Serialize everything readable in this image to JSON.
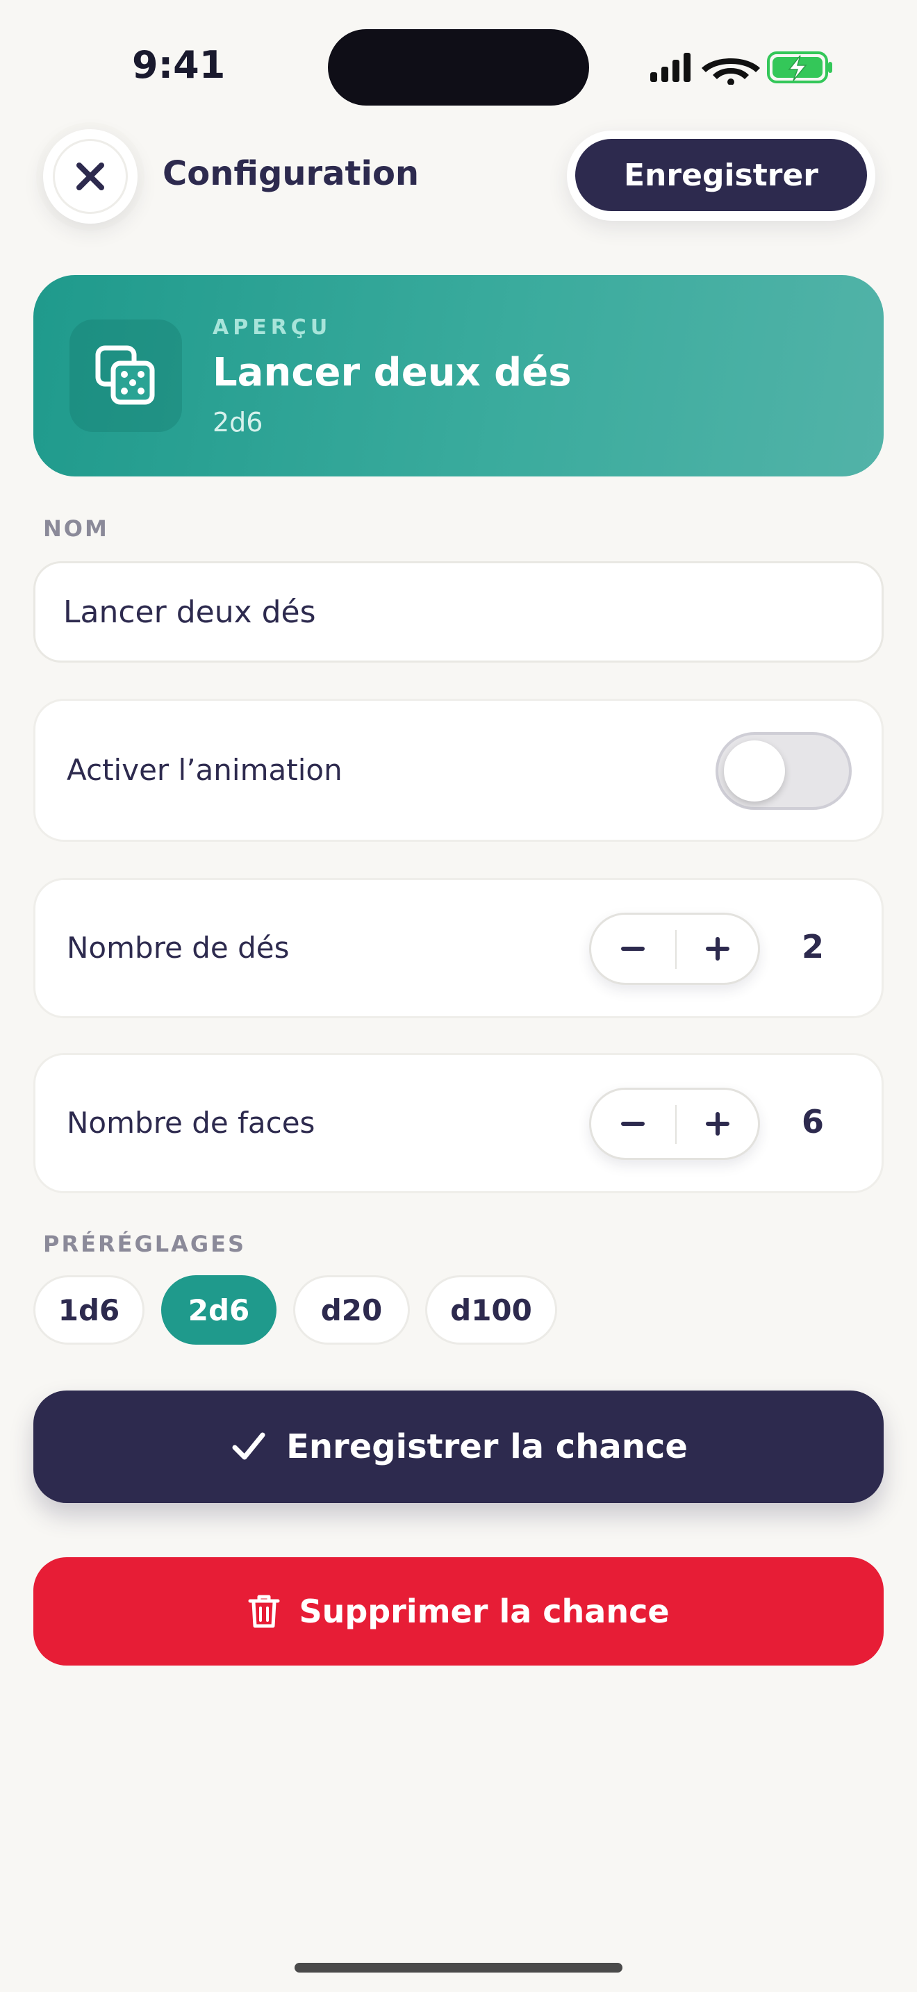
{
  "status_bar": {
    "time": "9:41",
    "icons": [
      "signal-icon",
      "wifi-icon",
      "battery-charging-icon"
    ],
    "battery_color": "#34C759"
  },
  "header": {
    "close_icon": "close-icon",
    "title": "Configuration",
    "save_label": "Enregistrer"
  },
  "preview": {
    "icon": "dice-icon",
    "eyebrow": "APERÇU",
    "title": "Lancer deux dés",
    "subtitle": "2d6",
    "accent": "#1F9A8C"
  },
  "name_section": {
    "label": "NOM",
    "value": "Lancer deux dés"
  },
  "animation_row": {
    "label": "Activer l’animation",
    "enabled": false
  },
  "dice_count_row": {
    "label": "Nombre de dés",
    "value": "2",
    "minus": "−",
    "plus": "+"
  },
  "faces_row": {
    "label": "Nombre de faces",
    "value": "6",
    "minus": "−",
    "plus": "+"
  },
  "presets": {
    "label": "PRÉRÉGLAGES",
    "items": [
      "1d6",
      "2d6",
      "d20",
      "d100"
    ],
    "selected": "2d6"
  },
  "actions": {
    "save_chance_label": "Enregistrer la chance",
    "save_icon": "checkmark-icon",
    "delete_chance_label": "Supprimer la chance",
    "delete_icon": "trash-icon",
    "primary_color": "#2D2A4E",
    "danger_color": "#E71D36"
  }
}
